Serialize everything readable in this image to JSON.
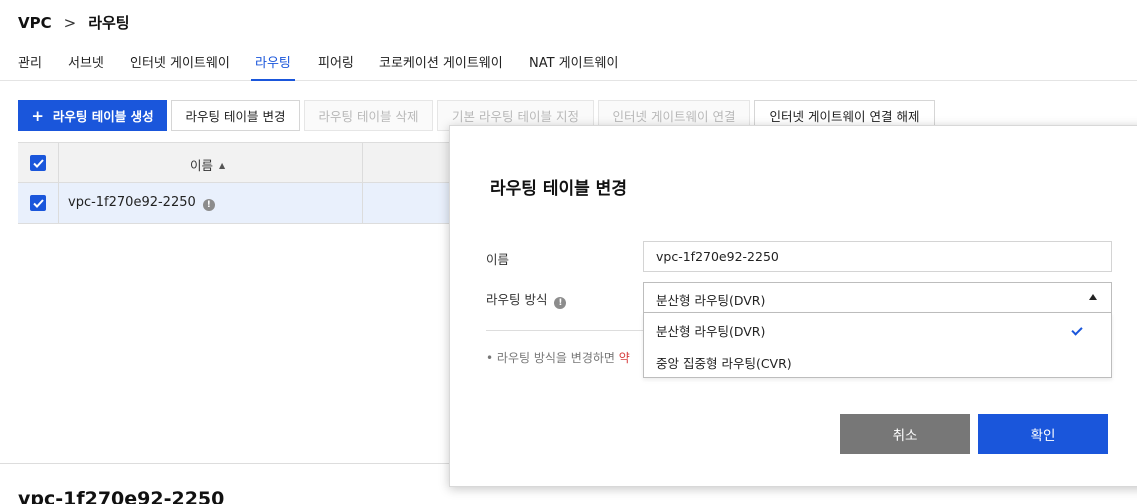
{
  "breadcrumb": {
    "root": "VPC",
    "separator": ">",
    "current": "라우팅"
  },
  "tabs": [
    "관리",
    "서브넷",
    "인터넷 게이트웨이",
    "라우팅",
    "피어링",
    "코로케이션 게이트웨이",
    "NAT 게이트웨이"
  ],
  "active_tab": "라우팅",
  "toolbar": {
    "create": "라우팅 테이블 생성",
    "change": "라우팅 테이블 변경",
    "delete": "라우팅 테이블 삭제",
    "set_default": "기본 라우팅 테이블 지정",
    "connect_igw": "인터넷 게이트웨이 연결",
    "disconnect_igw": "인터넷 게이트웨이 연결 해제"
  },
  "table": {
    "header_name": "이름",
    "rows": [
      {
        "name": "vpc-1f270e92-2250",
        "checked": true
      }
    ]
  },
  "detail_title": "vpc-1f270e92-2250",
  "modal": {
    "title": "라우팅 테이블 변경",
    "name_label": "이름",
    "name_value": "vpc-1f270e92-2250",
    "method_label": "라우팅 방식",
    "method_selected": "분산형 라우팅(DVR)",
    "options": [
      "분산형 라우팅(DVR)",
      "중앙 집중형 라우팅(CVR)"
    ],
    "note_prefix": "라우팅 방식을 변경하면",
    "note_highlight": "약",
    "cancel": "취소",
    "confirm": "확인"
  },
  "colors": {
    "primary": "#1a56db",
    "cancel": "#777777",
    "row_selected": "#e9f0fc"
  },
  "icons": {
    "add": "plus-icon",
    "sort": "sort-asc-icon",
    "info": "info-icon",
    "checked": "check-icon",
    "dropdown": "caret-up-icon"
  }
}
